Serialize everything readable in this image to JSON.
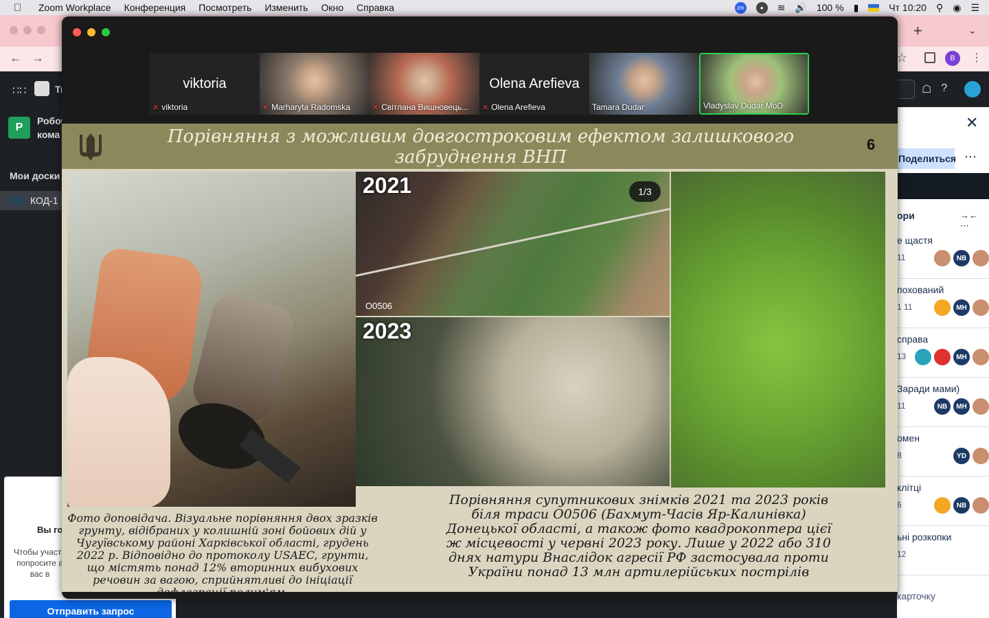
{
  "menubar": {
    "app": "Zoom Workplace",
    "items": [
      "Конференция",
      "Посмотреть",
      "Изменить",
      "Окно",
      "Справка"
    ],
    "zm_badge": "zm",
    "battery": "100 %",
    "clock": "Чт 10:20"
  },
  "browser": {
    "avatar_letter": "B",
    "trello_brand": "Tr"
  },
  "trello_sidebar": {
    "workspace_letter": "P",
    "workspace_name_line1": "Робоч",
    "workspace_name_line2": "кома",
    "boards_heading": "Мои доски",
    "board_name": "КОД-1",
    "invite_title": "Вы го",
    "invite_text": "Чтобы участн попросите а вас в",
    "invite_button": "Отправить запрос"
  },
  "trello_panel": {
    "share": "Поделиться",
    "column_title": "ори",
    "cards": [
      {
        "title": "е щастя",
        "meta": "11",
        "avatars": [
          "ph",
          "NB",
          "ph"
        ]
      },
      {
        "title": "похований",
        "meta": "1   11",
        "avatars": [
          "or",
          "MH",
          "ph"
        ]
      },
      {
        "title": "справа",
        "meta": "13",
        "avatars": [
          "tl",
          "rd",
          "MH",
          "ph"
        ]
      },
      {
        "title": "Заради мами)",
        "meta": "11",
        "avatars": [
          "NB",
          "MH",
          "ph"
        ]
      },
      {
        "title": "омен",
        "meta": "8",
        "avatars": [
          "YD",
          "ph"
        ]
      },
      {
        "title": "клітці",
        "meta": "6",
        "avatars": [
          "or",
          "NB",
          "ph"
        ]
      },
      {
        "title": "ьні розкопки",
        "meta": "12",
        "avatars": []
      }
    ],
    "add_card": "карточку"
  },
  "zoom": {
    "participants": [
      {
        "big": "viktoria",
        "label": "viktoria",
        "muted": true,
        "video": false
      },
      {
        "big": "",
        "label": "Marharyta Radomska",
        "muted": true,
        "video": true,
        "tone": "#8c7a6a"
      },
      {
        "big": "",
        "label": "Світлана Вишновець...",
        "muted": true,
        "video": true,
        "tone": "#b86a52"
      },
      {
        "big": "Olena Arefieva",
        "label": "Olena Arefieva",
        "muted": true,
        "video": false
      },
      {
        "big": "",
        "label": "Tamara Dudar",
        "muted": false,
        "video": true,
        "tone": "#6e7f95"
      },
      {
        "big": "",
        "label": "Vladyslav Dudar MoD",
        "muted": false,
        "video": true,
        "tone": "#9fc17a",
        "active": true
      }
    ]
  },
  "slide": {
    "title": "Порівняння з можливим довгостроковим ефектом залишкового забруднення ВНП",
    "page_number": "6",
    "year_top": "2021",
    "year_bottom": "2023",
    "pager": "1/3",
    "road_id": "О0506",
    "caption_left": "Фото доповідача. Візуальне порівняння двох зразків грунту, відібраних у колишній зоні бойових дій у Чугуївському районі Харківської області, грудень 2022 р. Відповідно до протоколу USAEC, грунти, що містять понад 12% вторинних вибухових речовин за вагою, сприйнятливі до ініціації дефлаграції полум'ям.",
    "caption_right": "Порівняння супутникових знімків 2021 та 2023 років біля траси О0506 (Бахмут-Часів Яр-Калинівка) Донецької області, а також фото квадрокоптера цієї ж місцевості у червні 2023 року. Лише у 2022 або 310 днях натури Внаслідок агресії РФ застосувала проти України понад 13 млн артилерійських пострілів"
  }
}
